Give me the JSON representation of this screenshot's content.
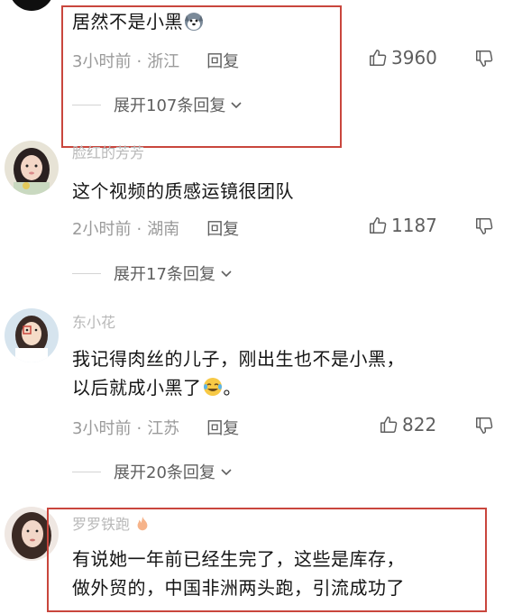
{
  "comments": [
    {
      "text": "居然不是小黑",
      "time": "3小时前",
      "location": "浙江",
      "reply_label": "回复",
      "likes": "3960",
      "expand_label": "展开107条回复",
      "emoji": "husky-dog-emoji"
    },
    {
      "username": "脸红的芳芳",
      "text": "这个视频的质感运镜很团队",
      "time": "2小时前",
      "location": "湖南",
      "reply_label": "回复",
      "likes": "1187",
      "expand_label": "展开17条回复"
    },
    {
      "username": "东小花",
      "text_line1": "我记得肉丝的儿子，刚出生也不是小黑，",
      "text_line2": "以后就成小黑了",
      "text_line2_end": "。",
      "emoji": "crying-laughing-emoji",
      "time": "3小时前",
      "location": "江苏",
      "reply_label": "回复",
      "likes": "822",
      "expand_label": "展开20条回复"
    },
    {
      "username": "罗罗铁跑",
      "badge": "fire-emoji",
      "text_line1": "有说她一年前已经生完了，这些是库存，",
      "text_line2": "做外贸的，中国非洲两头跑，引流成功了"
    }
  ],
  "icons": {
    "like": "thumbs-up-icon",
    "dislike": "thumbs-down-icon",
    "expand": "chevron-down-icon"
  },
  "colors": {
    "highlight": "#c9463d",
    "meta": "#9a9a9a",
    "text": "#151515"
  }
}
